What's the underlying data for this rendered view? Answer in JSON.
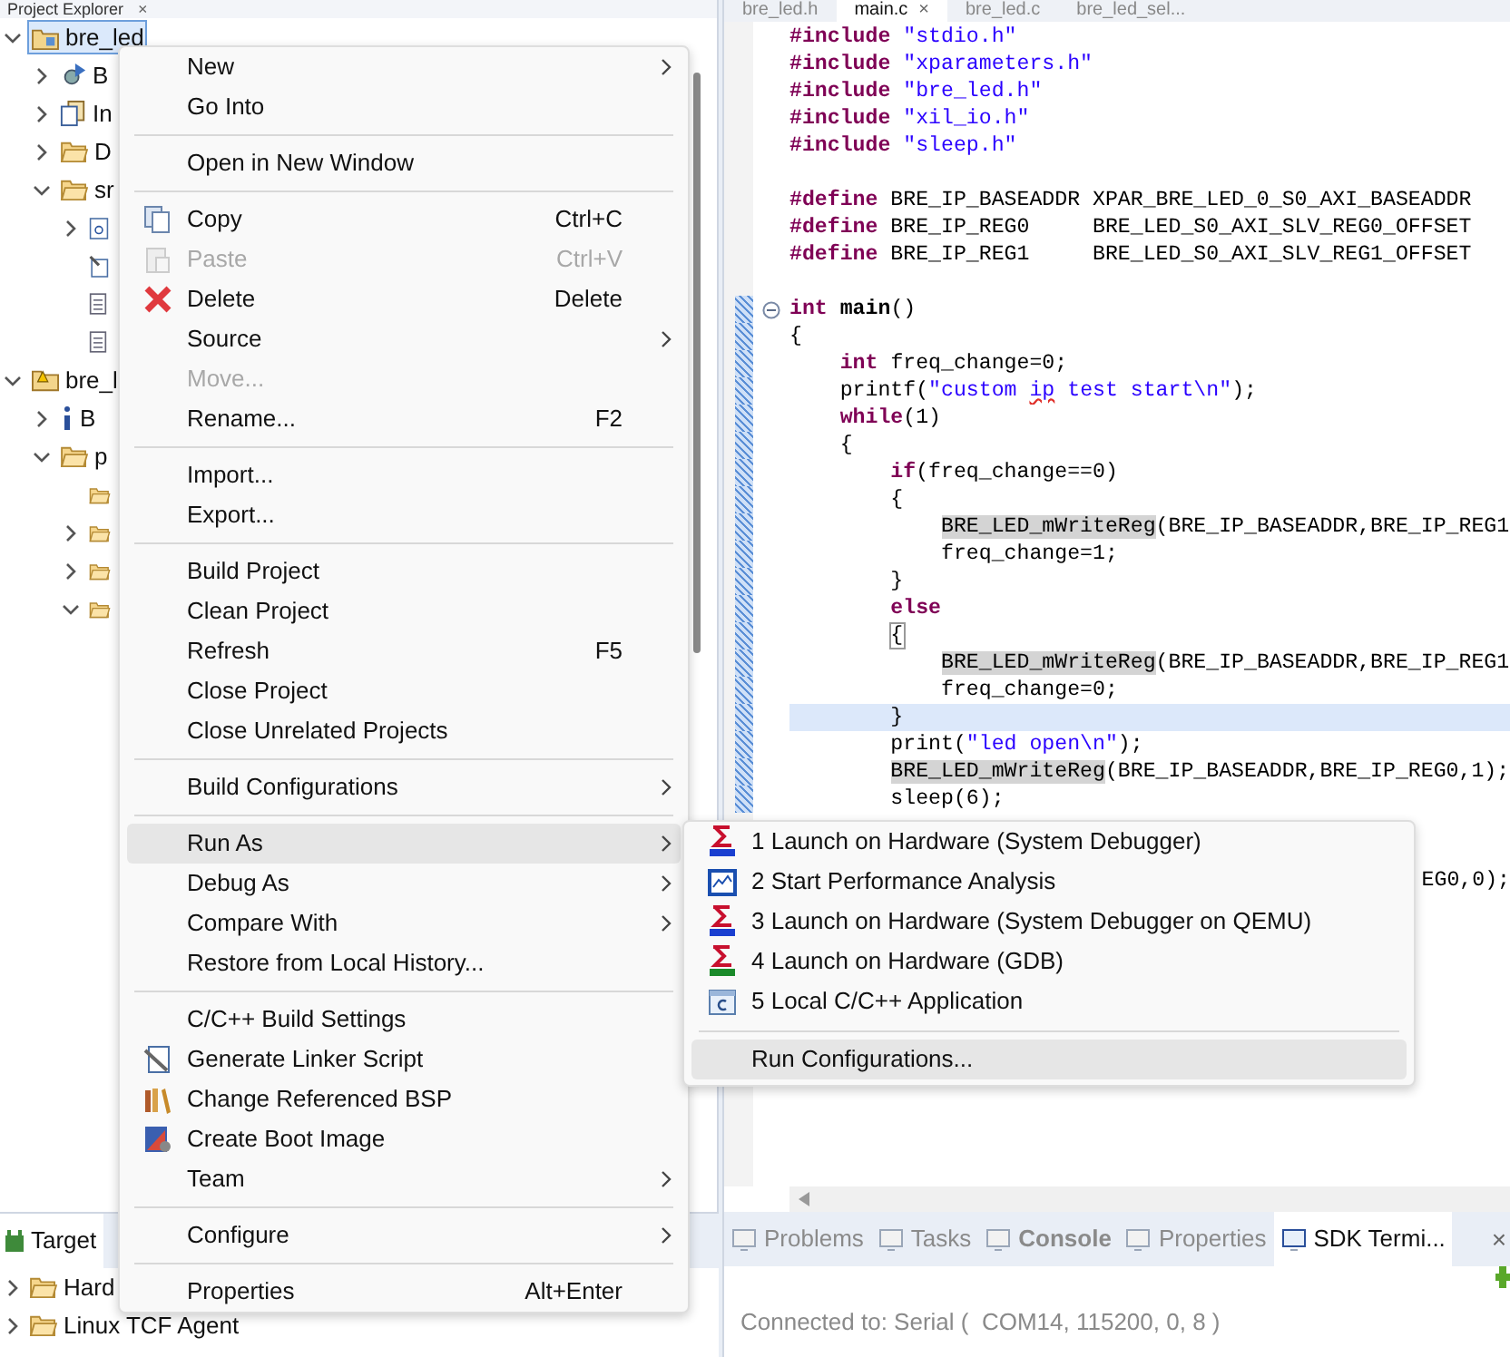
{
  "explorer": {
    "title": "Project Explorer",
    "close": "×",
    "tree": [
      {
        "label": "bre_led",
        "kind": "project",
        "selected": true,
        "expanded": true,
        "children": [
          {
            "label": "B",
            "kind": "binaries",
            "selected": false,
            "expanded": false
          },
          {
            "label": "In",
            "kind": "includes",
            "selected": false,
            "expanded": false
          },
          {
            "label": "D",
            "kind": "folder",
            "selected": false,
            "expanded": false
          },
          {
            "label": "sr",
            "kind": "folder",
            "selected": false,
            "expanded": true,
            "children": [
              {
                "kind": "source-file",
                "selected": false,
                "expanded": false
              },
              {
                "kind": "linked-file",
                "selected": false
              },
              {
                "kind": "text-file",
                "selected": false
              },
              {
                "kind": "text-file",
                "selected": false
              }
            ]
          }
        ]
      },
      {
        "label": "bre_l",
        "kind": "bsp",
        "selected": false,
        "expanded": true,
        "children": [
          {
            "label": "B",
            "kind": "info",
            "selected": false,
            "expanded": false
          },
          {
            "label": "p",
            "kind": "folder",
            "selected": false,
            "expanded": true,
            "children": [
              {
                "kind": "folder",
                "selected": false
              },
              {
                "kind": "folder",
                "selected": false,
                "expanded": false
              },
              {
                "kind": "folder",
                "selected": false,
                "expanded": false
              },
              {
                "kind": "folder",
                "selected": false,
                "expanded": true
              }
            ]
          }
        ]
      }
    ]
  },
  "target_panel": {
    "tab": "Target",
    "tree": [
      {
        "label": "Hard",
        "kind": "folder",
        "expanded": false
      },
      {
        "label": "Linux TCF Agent",
        "kind": "folder",
        "expanded": false
      }
    ]
  },
  "editor": {
    "tabs": [
      {
        "label": "bre_led.h",
        "selected": false
      },
      {
        "label": "main.c",
        "selected": true,
        "close": "×"
      },
      {
        "label": "bre_led.c",
        "selected": false
      },
      {
        "label": "bre_led_sel...",
        "selected": false
      }
    ],
    "lines": [
      {
        "kind": "code",
        "current": false,
        "changed": false,
        "segments": [
          {
            "kind": "keyword",
            "text": "#include"
          },
          {
            "kind": "string",
            "text": " \"stdio.h\""
          }
        ]
      },
      {
        "kind": "code",
        "current": false,
        "changed": false,
        "segments": [
          {
            "kind": "keyword",
            "text": "#include"
          },
          {
            "kind": "string",
            "text": " \"xparameters.h\""
          }
        ]
      },
      {
        "kind": "code",
        "current": false,
        "changed": false,
        "segments": [
          {
            "kind": "keyword",
            "text": "#include"
          },
          {
            "kind": "string",
            "text": " \"bre_led.h\""
          }
        ]
      },
      {
        "kind": "code",
        "current": false,
        "changed": false,
        "segments": [
          {
            "kind": "keyword",
            "text": "#include"
          },
          {
            "kind": "string",
            "text": " \"xil_io.h\""
          }
        ]
      },
      {
        "kind": "code",
        "current": false,
        "changed": false,
        "segments": [
          {
            "kind": "keyword",
            "text": "#include"
          },
          {
            "kind": "string",
            "text": " \"sleep.h\""
          }
        ]
      },
      {
        "kind": "blank"
      },
      {
        "kind": "code",
        "current": false,
        "changed": false,
        "segments": [
          {
            "kind": "keyword",
            "text": "#define"
          },
          {
            "kind": "plain",
            "text": " BRE_IP_BASEADDR XPAR_BRE_LED_0_S0_AXI_BASEADDR"
          }
        ]
      },
      {
        "kind": "code",
        "current": false,
        "changed": false,
        "segments": [
          {
            "kind": "keyword",
            "text": "#define"
          },
          {
            "kind": "plain",
            "text": " BRE_IP_REG0     BRE_LED_S0_AXI_SLV_REG0_OFFSET"
          }
        ]
      },
      {
        "kind": "code",
        "current": false,
        "changed": false,
        "segments": [
          {
            "kind": "keyword",
            "text": "#define"
          },
          {
            "kind": "plain",
            "text": " BRE_IP_REG1     BRE_LED_S0_AXI_SLV_REG1_OFFSET"
          }
        ]
      },
      {
        "kind": "blank"
      },
      {
        "kind": "code",
        "current": false,
        "changed": true,
        "folded": false,
        "segments": [
          {
            "kind": "keyword",
            "text": "int"
          },
          {
            "kind": "function",
            "text": " main"
          },
          {
            "kind": "plain",
            "text": "()"
          }
        ]
      },
      {
        "kind": "code",
        "current": false,
        "changed": true,
        "segments": [
          {
            "kind": "plain",
            "text": "{"
          }
        ]
      },
      {
        "kind": "code",
        "current": false,
        "changed": true,
        "segments": [
          {
            "kind": "keyword",
            "text": "    int"
          },
          {
            "kind": "plain",
            "text": " freq_change=0;"
          }
        ]
      },
      {
        "kind": "code",
        "current": false,
        "changed": true,
        "segments": [
          {
            "kind": "plain",
            "text": "    printf("
          },
          {
            "kind": "string",
            "text": "\"custom "
          },
          {
            "kind": "misspelled",
            "text": "ip"
          },
          {
            "kind": "string",
            "text": " test start\\n\""
          },
          {
            "kind": "plain",
            "text": ");"
          }
        ]
      },
      {
        "kind": "code",
        "current": false,
        "changed": true,
        "segments": [
          {
            "kind": "keyword",
            "text": "    while"
          },
          {
            "kind": "plain",
            "text": "(1)"
          }
        ]
      },
      {
        "kind": "code",
        "current": false,
        "changed": true,
        "segments": [
          {
            "kind": "plain",
            "text": "    {"
          }
        ]
      },
      {
        "kind": "code",
        "current": false,
        "changed": true,
        "segments": [
          {
            "kind": "keyword",
            "text": "        if"
          },
          {
            "kind": "plain",
            "text": "(freq_change==0)"
          }
        ]
      },
      {
        "kind": "code",
        "current": false,
        "changed": true,
        "segments": [
          {
            "kind": "plain",
            "text": "        {"
          }
        ]
      },
      {
        "kind": "code",
        "current": false,
        "changed": true,
        "segments": [
          {
            "kind": "occurrence",
            "text": "            BRE_LED_mWriteReg"
          },
          {
            "kind": "plain",
            "text": "(BRE_IP_BASEADDR,BRE_IP_REG1"
          }
        ]
      },
      {
        "kind": "code",
        "current": false,
        "changed": true,
        "segments": [
          {
            "kind": "plain",
            "text": "            freq_change=1;"
          }
        ]
      },
      {
        "kind": "code",
        "current": false,
        "changed": true,
        "segments": [
          {
            "kind": "plain",
            "text": "        }"
          }
        ]
      },
      {
        "kind": "code",
        "current": false,
        "changed": true,
        "segments": [
          {
            "kind": "keyword",
            "text": "        else"
          }
        ]
      },
      {
        "kind": "code",
        "current": false,
        "changed": true,
        "segments": [
          {
            "kind": "bracket",
            "text": "        {"
          }
        ]
      },
      {
        "kind": "code",
        "current": false,
        "changed": true,
        "segments": [
          {
            "kind": "occurrence",
            "text": "            BRE_LED_mWriteReg"
          },
          {
            "kind": "plain",
            "text": "(BRE_IP_BASEADDR,BRE_IP_REG1"
          }
        ]
      },
      {
        "kind": "code",
        "current": false,
        "changed": true,
        "segments": [
          {
            "kind": "plain",
            "text": "            freq_change=0;"
          }
        ]
      },
      {
        "kind": "code",
        "current": true,
        "changed": true,
        "segments": [
          {
            "kind": "plain",
            "text": "        }"
          }
        ]
      },
      {
        "kind": "code",
        "current": false,
        "changed": true,
        "segments": [
          {
            "kind": "plain",
            "text": "        print("
          },
          {
            "kind": "string",
            "text": "\"led open\\n\""
          },
          {
            "kind": "plain",
            "text": ");"
          }
        ]
      },
      {
        "kind": "code",
        "current": false,
        "changed": true,
        "segments": [
          {
            "kind": "occurrence",
            "text": "        BRE_LED_mWriteReg"
          },
          {
            "kind": "plain",
            "text": "(BRE_IP_BASEADDR,BRE_IP_REG0,1);"
          }
        ]
      },
      {
        "kind": "code",
        "current": false,
        "changed": true,
        "segments": [
          {
            "kind": "plain",
            "text": "        sleep(6);"
          }
        ]
      },
      {
        "kind": "fragment",
        "segments": [
          {
            "kind": "plain",
            "text": "EG0,0);"
          }
        ]
      }
    ]
  },
  "context_menu": {
    "items": [
      {
        "kind": "item",
        "label": "New",
        "submenu": true,
        "disabled": false,
        "selected": false
      },
      {
        "kind": "item",
        "label": "Go Into",
        "submenu": false,
        "disabled": false,
        "selected": false
      },
      {
        "kind": "separator"
      },
      {
        "kind": "item",
        "label": "Open in New Window",
        "submenu": false,
        "disabled": false,
        "selected": false
      },
      {
        "kind": "separator"
      },
      {
        "kind": "item",
        "label": "Copy",
        "shortcut": "Ctrl+C",
        "submenu": false,
        "disabled": false,
        "selected": false
      },
      {
        "kind": "item",
        "label": "Paste",
        "shortcut": "Ctrl+V",
        "submenu": false,
        "disabled": true,
        "selected": false
      },
      {
        "kind": "item",
        "label": "Delete",
        "shortcut": "Delete",
        "submenu": false,
        "disabled": false,
        "selected": false
      },
      {
        "kind": "item",
        "label": "Source",
        "submenu": true,
        "disabled": false,
        "selected": false
      },
      {
        "kind": "item",
        "label": "Move...",
        "submenu": false,
        "disabled": true,
        "selected": false
      },
      {
        "kind": "item",
        "label": "Rename...",
        "shortcut": "F2",
        "submenu": false,
        "disabled": false,
        "selected": false
      },
      {
        "kind": "separator"
      },
      {
        "kind": "item",
        "label": "Import...",
        "submenu": false,
        "disabled": false,
        "selected": false
      },
      {
        "kind": "item",
        "label": "Export...",
        "submenu": false,
        "disabled": false,
        "selected": false
      },
      {
        "kind": "separator"
      },
      {
        "kind": "item",
        "label": "Build Project",
        "submenu": false,
        "disabled": false,
        "selected": false
      },
      {
        "kind": "item",
        "label": "Clean Project",
        "submenu": false,
        "disabled": false,
        "selected": false
      },
      {
        "kind": "item",
        "label": "Refresh",
        "shortcut": "F5",
        "submenu": false,
        "disabled": false,
        "selected": false
      },
      {
        "kind": "item",
        "label": "Close Project",
        "submenu": false,
        "disabled": false,
        "selected": false
      },
      {
        "kind": "item",
        "label": "Close Unrelated Projects",
        "submenu": false,
        "disabled": false,
        "selected": false
      },
      {
        "kind": "separator"
      },
      {
        "kind": "item",
        "label": "Build Configurations",
        "submenu": true,
        "disabled": false,
        "selected": false
      },
      {
        "kind": "separator"
      },
      {
        "kind": "item",
        "label": "Run As",
        "submenu": true,
        "disabled": false,
        "selected": true
      },
      {
        "kind": "item",
        "label": "Debug As",
        "submenu": true,
        "disabled": false,
        "selected": false
      },
      {
        "kind": "item",
        "label": "Compare With",
        "submenu": true,
        "disabled": false,
        "selected": false
      },
      {
        "kind": "item",
        "label": "Restore from Local History...",
        "submenu": false,
        "disabled": false,
        "selected": false
      },
      {
        "kind": "separator"
      },
      {
        "kind": "item",
        "label": "C/C++ Build Settings",
        "submenu": false,
        "disabled": false,
        "selected": false
      },
      {
        "kind": "item",
        "label": "Generate Linker Script",
        "submenu": false,
        "disabled": false,
        "selected": false
      },
      {
        "kind": "item",
        "label": "Change Referenced BSP",
        "submenu": false,
        "disabled": false,
        "selected": false
      },
      {
        "kind": "item",
        "label": "Create Boot Image",
        "submenu": false,
        "disabled": false,
        "selected": false
      },
      {
        "kind": "item",
        "label": "Team",
        "submenu": true,
        "disabled": false,
        "selected": false
      },
      {
        "kind": "separator"
      },
      {
        "kind": "item",
        "label": "Configure",
        "submenu": true,
        "disabled": false,
        "selected": false
      },
      {
        "kind": "separator"
      },
      {
        "kind": "item",
        "label": "Properties",
        "shortcut": "Alt+Enter",
        "submenu": false,
        "disabled": false,
        "selected": false
      }
    ]
  },
  "run_as_menu": {
    "items": [
      {
        "kind": "item",
        "label": "1 Launch on Hardware (System Debugger)",
        "selected": false
      },
      {
        "kind": "item",
        "label": "2 Start Performance Analysis",
        "selected": false
      },
      {
        "kind": "item",
        "label": "3 Launch on Hardware (System Debugger on QEMU)",
        "selected": false
      },
      {
        "kind": "item",
        "label": "4 Launch on Hardware (GDB)",
        "selected": false
      },
      {
        "kind": "item",
        "label": "5 Local C/C++ Application",
        "selected": false
      },
      {
        "kind": "separator"
      },
      {
        "kind": "item",
        "label": "Run Configurations...",
        "selected": true
      }
    ]
  },
  "console": {
    "tabs": [
      {
        "label": "Problems",
        "selected": false,
        "emphasized": false
      },
      {
        "label": "Tasks",
        "selected": false,
        "emphasized": false
      },
      {
        "label": "Console",
        "selected": false,
        "emphasized": true
      },
      {
        "label": "Properties",
        "selected": false,
        "emphasized": false
      },
      {
        "label": "SDK Termi...",
        "selected": true,
        "emphasized": false
      }
    ],
    "close": "×",
    "status": "Connected to: Serial (  COM14, 115200, 0, 8 )"
  }
}
